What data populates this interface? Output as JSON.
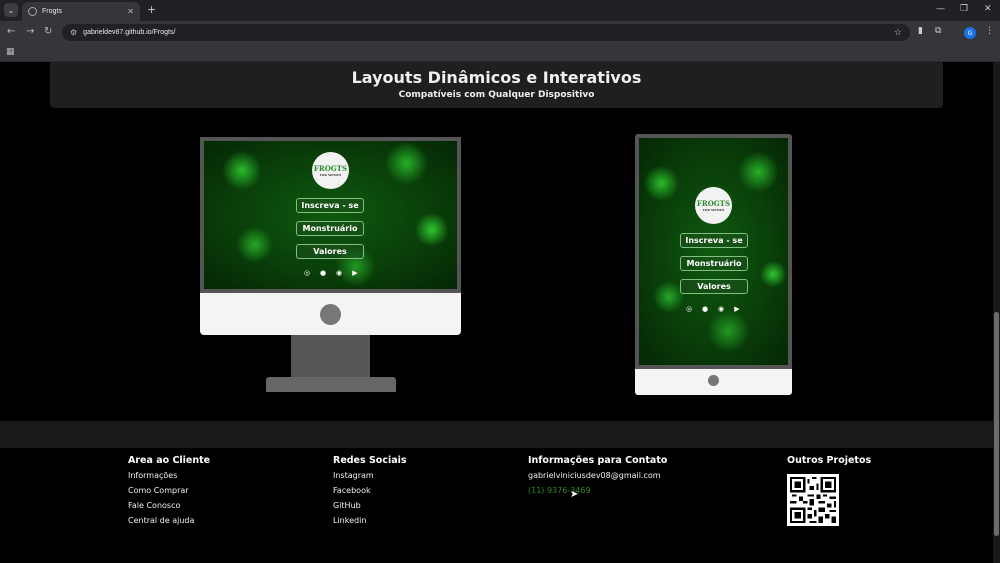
{
  "browser": {
    "tab_title": "Frogts",
    "url": "gabrieldev87.github.io/Frogts/",
    "profile_initial": "G"
  },
  "hero": {
    "title": "Layouts Dinâmicos e Interativos",
    "subtitle": "Compatíveis com Qualquer Dispositivo"
  },
  "mockup": {
    "logo_text": "FROGTS",
    "logo_sub": "FOR MEMES",
    "buttons": [
      "Inscreva - se",
      "Monstruário",
      "Valores"
    ]
  },
  "footer": {
    "col1": {
      "title": "Area ao Cliente",
      "links": [
        "Informações",
        "Como Comprar",
        "Fale Conosco",
        "Central de ajuda"
      ]
    },
    "col2": {
      "title": "Redes Sociais",
      "links": [
        "Instagram",
        "Facebook",
        "GitHub",
        "Linkedin"
      ]
    },
    "col3": {
      "title": "Informações para Contato",
      "email": "gabrielviniciusdev08@gmail.com",
      "phone": "(11) 9376-3469"
    },
    "col4": {
      "title": "Outros Projetos"
    }
  },
  "colors": {
    "accent_green": "#2e8b2e",
    "page_bg": "#000000",
    "panel_bg": "#1f1f1f"
  }
}
